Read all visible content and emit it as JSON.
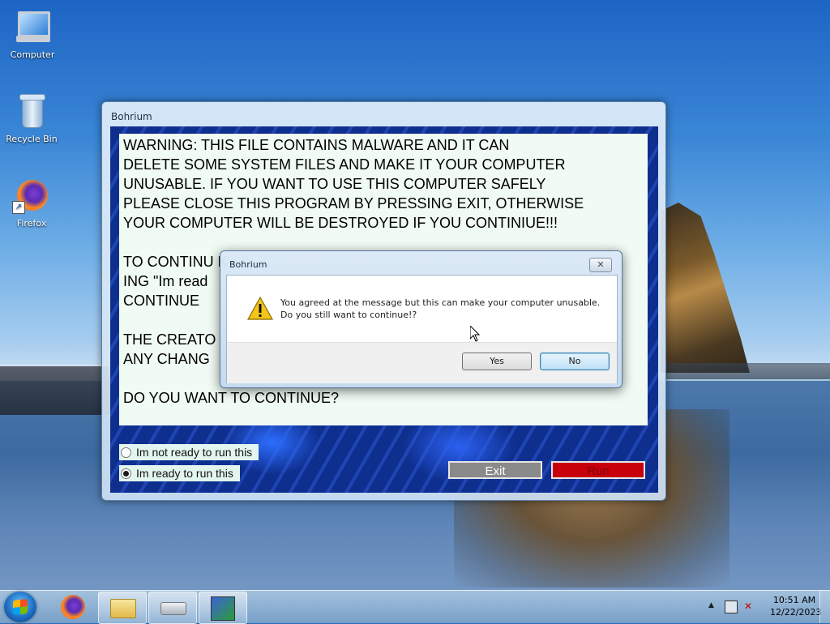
{
  "desktop": {
    "icons": [
      {
        "label": "Computer",
        "icon": "computer-icon"
      },
      {
        "label": "Recycle Bin",
        "icon": "recycle-bin-icon"
      },
      {
        "label": "Firefox",
        "icon": "firefox-icon"
      }
    ]
  },
  "app": {
    "title": "Bohrium",
    "warning_text": "WARNING: THIS FILE CONTAINS MALWARE AND IT CAN\nDELETE SOME SYSTEM FILES AND MAKE IT YOUR COMPUTER\nUNUSABLE. IF YOU WANT TO USE THIS COMPUTER SAFELY\nPLEASE CLOSE THIS PROGRAM BY PRESSING EXIT, OTHERWISE\nYOUR COMPUTER WILL BE DESTROYED IF YOU CONTINIUE!!!\n\nTO CONTINU                                                                     K-\nING \"Im read\nCONTINUE\n\nTHE CREATO\nANY CHANG\n\nDO YOU WANT TO CONTINUE?",
    "radio_not_ready": "Im not ready to run this",
    "radio_ready": "Im ready to run this",
    "selected_radio": "Im ready to run this",
    "exit_label": "Exit",
    "run_label": "Run"
  },
  "dialog": {
    "title": "Bohrium",
    "message": "You agreed at the message but this can make your computer unusable.\nDo you still want to continue!?",
    "yes_label": "Yes",
    "no_label": "No",
    "close_glyph": "✕",
    "icon": "warning-icon"
  },
  "taskbar": {
    "pinned": [
      "firefox-icon",
      "explorer-icon",
      "drive-icon",
      "bohrium-icon"
    ],
    "clock_time": "10:51 AM",
    "clock_date": "12/22/2023"
  },
  "colors": {
    "run_button": "#c8000b",
    "exit_button": "#8a8a8a",
    "app_background": "#0f2f8f",
    "warning_panel": "#f0fbf3"
  }
}
